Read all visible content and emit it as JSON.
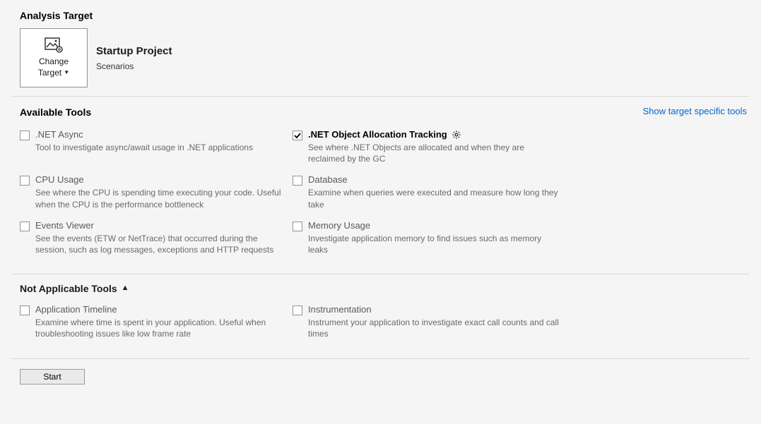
{
  "analysisTarget": {
    "header": "Analysis Target",
    "changeTarget": {
      "line1": "Change",
      "line2": "Target"
    },
    "title": "Startup Project",
    "subtitle": "Scenarios"
  },
  "availableTools": {
    "header": "Available Tools",
    "showSpecific": "Show target specific tools",
    "items": [
      {
        "label": ".NET Async",
        "desc": "Tool to investigate async/await usage in .NET applications",
        "checked": false,
        "gear": false
      },
      {
        "label": ".NET Object Allocation Tracking",
        "desc": "See where .NET Objects are allocated and when they are reclaimed by the GC",
        "checked": true,
        "gear": true
      },
      {
        "label": "CPU Usage",
        "desc": "See where the CPU is spending time executing your code. Useful when the CPU is the performance bottleneck",
        "checked": false,
        "gear": false
      },
      {
        "label": "Database",
        "desc": "Examine when queries were executed and measure how long they take",
        "checked": false,
        "gear": false
      },
      {
        "label": "Events Viewer",
        "desc": "See the events (ETW or NetTrace) that occurred during the session, such as log messages, exceptions and HTTP requests",
        "checked": false,
        "gear": false
      },
      {
        "label": "Memory Usage",
        "desc": "Investigate application memory to find issues such as memory leaks",
        "checked": false,
        "gear": false
      }
    ]
  },
  "notApplicable": {
    "header": "Not Applicable Tools",
    "items": [
      {
        "label": "Application Timeline",
        "desc": "Examine where time is spent in your application. Useful when troubleshooting issues like low frame rate",
        "checked": false,
        "gear": false
      },
      {
        "label": "Instrumentation",
        "desc": "Instrument your application to investigate exact call counts and call times",
        "checked": false,
        "gear": false
      }
    ]
  },
  "start": "Start"
}
